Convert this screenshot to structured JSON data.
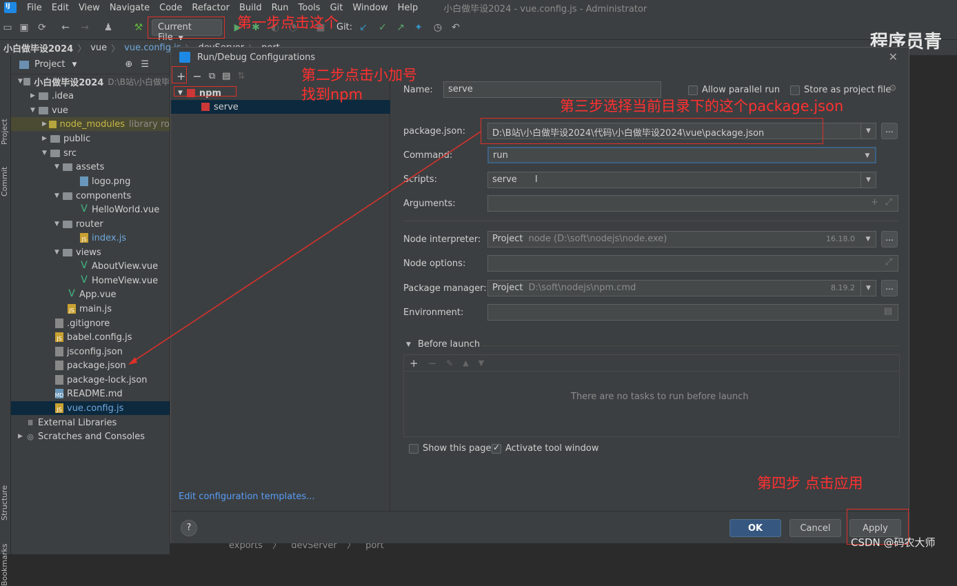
{
  "menubar": {
    "items": [
      "File",
      "Edit",
      "View",
      "Navigate",
      "Code",
      "Refactor",
      "Build",
      "Run",
      "Tools",
      "Git",
      "Window",
      "Help"
    ],
    "window_title": "小白做毕设2024 - vue.config.js - Administrator"
  },
  "toolbar": {
    "run_config": "Current File",
    "git_label": "Git:"
  },
  "navbar": {
    "crumbs": [
      "小白做毕设2024",
      "vue",
      "vue.config.js",
      "devServer",
      "port"
    ]
  },
  "watermark_top": "程序员青",
  "watermark_bottom": "CSDN @码农大师",
  "sidebar_tabs": {
    "project": "Project",
    "commit": "Commit",
    "structure": "Structure",
    "bookmarks": "Bookmarks"
  },
  "project_panel": {
    "title": "Project",
    "tree": [
      {
        "label": "小白做毕设2024",
        "extra": "D:\\B站\\小白做毕"
      },
      {
        "label": ".idea"
      },
      {
        "label": "vue"
      },
      {
        "label": "node_modules",
        "extra": "library ro"
      },
      {
        "label": "public"
      },
      {
        "label": "src"
      },
      {
        "label": "assets"
      },
      {
        "label": "logo.png"
      },
      {
        "label": "components"
      },
      {
        "label": "HelloWorld.vue"
      },
      {
        "label": "router"
      },
      {
        "label": "index.js"
      },
      {
        "label": "views"
      },
      {
        "label": "AboutView.vue"
      },
      {
        "label": "HomeView.vue"
      },
      {
        "label": "App.vue"
      },
      {
        "label": "main.js"
      },
      {
        "label": ".gitignore"
      },
      {
        "label": "babel.config.js"
      },
      {
        "label": "jsconfig.json"
      },
      {
        "label": "package.json"
      },
      {
        "label": "package-lock.json"
      },
      {
        "label": "README.md"
      },
      {
        "label": "vue.config.js"
      },
      {
        "label": "External Libraries"
      },
      {
        "label": "Scratches and Consoles"
      }
    ]
  },
  "editor_bottom": {
    "crumbs": [
      "exports",
      "devServer",
      "port"
    ]
  },
  "dialog": {
    "title": "Run/Debug Configurations",
    "tree": {
      "group": "npm",
      "item": "serve"
    },
    "edit_templates": "Edit configuration templates...",
    "name_label": "Name:",
    "name_value": "serve",
    "allow_parallel": "Allow parallel run",
    "store_as_file": "Store as project file",
    "package_json_label": "package.json:",
    "package_json_value": "D:\\B站\\小白做毕设2024\\代码\\小白做毕设2024\\vue\\package.json",
    "command_label": "Command:",
    "command_value": "run",
    "scripts_label": "Scripts:",
    "scripts_value": "serve",
    "arguments_label": "Arguments:",
    "node_interpreter_label": "Node interpreter:",
    "node_interpreter_prefix": "Project",
    "node_interpreter_value": "node (D:\\soft\\nodejs\\node.exe)",
    "node_version": "16.18.0",
    "node_options_label": "Node options:",
    "package_manager_label": "Package manager:",
    "package_manager_prefix": "Project",
    "package_manager_value": "D:\\soft\\nodejs\\npm.cmd",
    "npm_version": "8.19.2",
    "environment_label": "Environment:",
    "before_launch": "Before launch",
    "no_tasks": "There are no tasks to run before launch",
    "show_page": "Show this page",
    "activate_tool": "Activate tool window",
    "ok": "OK",
    "cancel": "Cancel",
    "apply": "Apply",
    "help": "?"
  },
  "annotations": {
    "step1": "第一步点击这个",
    "step2a": "第二步点击小加号",
    "step2b": "找到npm",
    "step3": "第三步选择当前目录下的这个package.json",
    "step4": "第四步 点击应用"
  },
  "colors": {
    "annotation": "#ff3030",
    "accent": "#365880",
    "selection": "#0d293e"
  }
}
